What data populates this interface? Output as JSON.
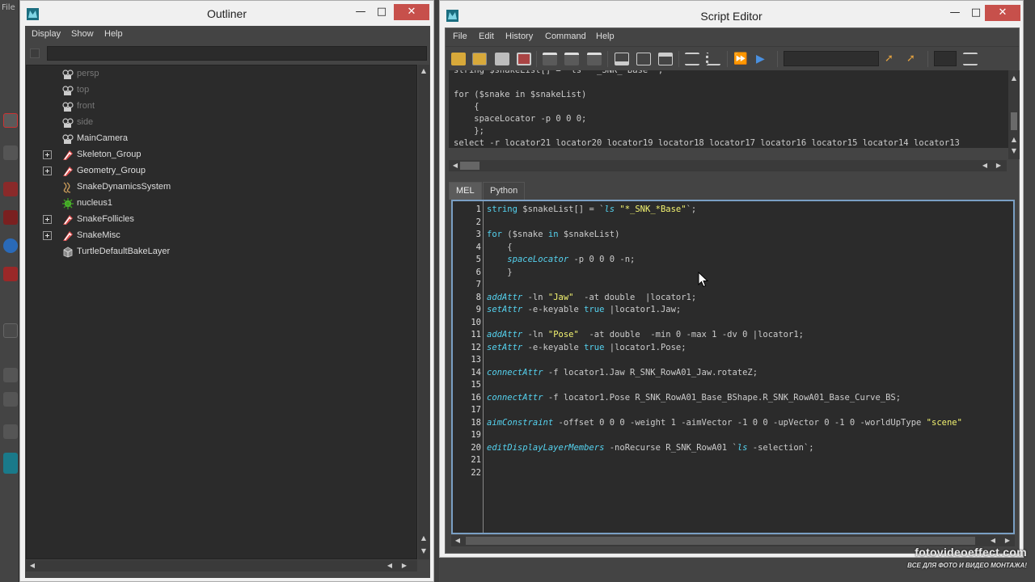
{
  "background": {
    "left_strip_text": "File"
  },
  "outliner": {
    "title": "Outliner",
    "menu": [
      "Display",
      "Show",
      "Help"
    ],
    "filter_value": "",
    "items": [
      {
        "label": "persp",
        "icon": "camera-icon",
        "dim": true,
        "expandable": false
      },
      {
        "label": "top",
        "icon": "camera-icon",
        "dim": true,
        "expandable": false
      },
      {
        "label": "front",
        "icon": "camera-icon",
        "dim": true,
        "expandable": false
      },
      {
        "label": "side",
        "icon": "camera-icon",
        "dim": true,
        "expandable": false
      },
      {
        "label": "MainCamera",
        "icon": "camera-icon",
        "dim": false,
        "expandable": false
      },
      {
        "label": "Skeleton_Group",
        "icon": "transform-icon",
        "dim": false,
        "expandable": true
      },
      {
        "label": "Geometry_Group",
        "icon": "transform-icon",
        "dim": false,
        "expandable": true
      },
      {
        "label": "SnakeDynamicsSystem",
        "icon": "hair-system-icon",
        "dim": false,
        "expandable": false
      },
      {
        "label": "nucleus1",
        "icon": "nucleus-icon",
        "dim": false,
        "expandable": false
      },
      {
        "label": "SnakeFollicles",
        "icon": "transform-icon",
        "dim": false,
        "expandable": true
      },
      {
        "label": "SnakeMisc",
        "icon": "transform-icon",
        "dim": false,
        "expandable": true
      },
      {
        "label": "TurtleDefaultBakeLayer",
        "icon": "bake-layer-icon",
        "dim": false,
        "expandable": false
      }
    ]
  },
  "script_editor": {
    "title": "Script Editor",
    "menu": [
      "File",
      "Edit",
      "History",
      "Command",
      "Help"
    ],
    "history_lines": [
      "string $snakeList[] = `ls \"*_SNK_*Base\"`;",
      "",
      "for ($snake in $snakeList)",
      "    {",
      "    spaceLocator -p 0 0 0;",
      "    };",
      "select -r locator21 locator20 locator19 locator18 locator17 locator16 locator15 locator14 locator13"
    ],
    "tabs": [
      "MEL",
      "Python"
    ],
    "active_tab": "MEL",
    "code_lines": [
      {
        "n": "1",
        "tokens": [
          [
            "kw",
            "string"
          ],
          [
            "plain",
            " $snakeList[] = `"
          ],
          [
            "cmd",
            "ls"
          ],
          [
            "plain",
            " "
          ],
          [
            "str",
            "\"*_SNK_*Base\""
          ],
          [
            "plain",
            "`;"
          ]
        ]
      },
      {
        "n": "2",
        "tokens": []
      },
      {
        "n": "3",
        "tokens": [
          [
            "kw",
            "for"
          ],
          [
            "plain",
            " ($snake "
          ],
          [
            "kw",
            "in"
          ],
          [
            "plain",
            " $snakeList)"
          ]
        ]
      },
      {
        "n": "4",
        "tokens": [
          [
            "plain",
            "    {"
          ]
        ]
      },
      {
        "n": "5",
        "tokens": [
          [
            "plain",
            "    "
          ],
          [
            "cmd",
            "spaceLocator"
          ],
          [
            "plain",
            " -p 0 0 0 -n;"
          ]
        ]
      },
      {
        "n": "6",
        "tokens": [
          [
            "plain",
            "    }"
          ]
        ]
      },
      {
        "n": "7",
        "tokens": []
      },
      {
        "n": "8",
        "tokens": [
          [
            "cmd",
            "addAttr"
          ],
          [
            "plain",
            " -ln "
          ],
          [
            "str",
            "\"Jaw\""
          ],
          [
            "plain",
            "  -at double  |locator1;"
          ]
        ]
      },
      {
        "n": "9",
        "tokens": [
          [
            "cmd",
            "setAttr"
          ],
          [
            "plain",
            " -e-keyable "
          ],
          [
            "kw",
            "true"
          ],
          [
            "plain",
            " |locator1.Jaw;"
          ]
        ]
      },
      {
        "n": "10",
        "tokens": []
      },
      {
        "n": "11",
        "tokens": [
          [
            "cmd",
            "addAttr"
          ],
          [
            "plain",
            " -ln "
          ],
          [
            "str",
            "\"Pose\""
          ],
          [
            "plain",
            "  -at double  -min 0 -max 1 -dv 0 |locator1;"
          ]
        ]
      },
      {
        "n": "12",
        "tokens": [
          [
            "cmd",
            "setAttr"
          ],
          [
            "plain",
            " -e-keyable "
          ],
          [
            "kw",
            "true"
          ],
          [
            "plain",
            " |locator1.Pose;"
          ]
        ]
      },
      {
        "n": "13",
        "tokens": []
      },
      {
        "n": "14",
        "tokens": [
          [
            "cmd",
            "connectAttr"
          ],
          [
            "plain",
            " -f locator1.Jaw R_SNK_RowA01_Jaw.rotateZ;"
          ]
        ]
      },
      {
        "n": "15",
        "tokens": []
      },
      {
        "n": "16",
        "tokens": [
          [
            "cmd",
            "connectAttr"
          ],
          [
            "plain",
            " -f locator1.Pose R_SNK_RowA01_Base_BShape.R_SNK_RowA01_Base_Curve_BS;"
          ]
        ]
      },
      {
        "n": "17",
        "tokens": []
      },
      {
        "n": "18",
        "tokens": [
          [
            "cmd",
            "aimConstraint"
          ],
          [
            "plain",
            " -offset 0 0 0 -weight 1 -aimVector -1 0 0 -upVector 0 -1 0 -worldUpType "
          ],
          [
            "str",
            "\"scene\""
          ]
        ]
      },
      {
        "n": "19",
        "tokens": []
      },
      {
        "n": "20",
        "tokens": [
          [
            "cmd",
            "editDisplayLayerMembers"
          ],
          [
            "plain",
            " -noRecurse R_SNK_RowA01 `"
          ],
          [
            "cmd",
            "ls"
          ],
          [
            "plain",
            " -selection`;"
          ]
        ]
      },
      {
        "n": "21",
        "tokens": []
      },
      {
        "n": "22",
        "tokens": []
      }
    ]
  },
  "watermark": {
    "line1": "fotovideoeffect.com",
    "line2": "ВСЕ ДЛЯ ФОТО И ВИДЕО МОНТАЖА!"
  },
  "colors": {
    "keyword": "#55d3f0",
    "string": "#f3f370",
    "editor_bg": "#2b2b2b",
    "panel_bg": "#444444",
    "close_button": "#c7504b",
    "code_focus_border": "#7a9fc4"
  }
}
